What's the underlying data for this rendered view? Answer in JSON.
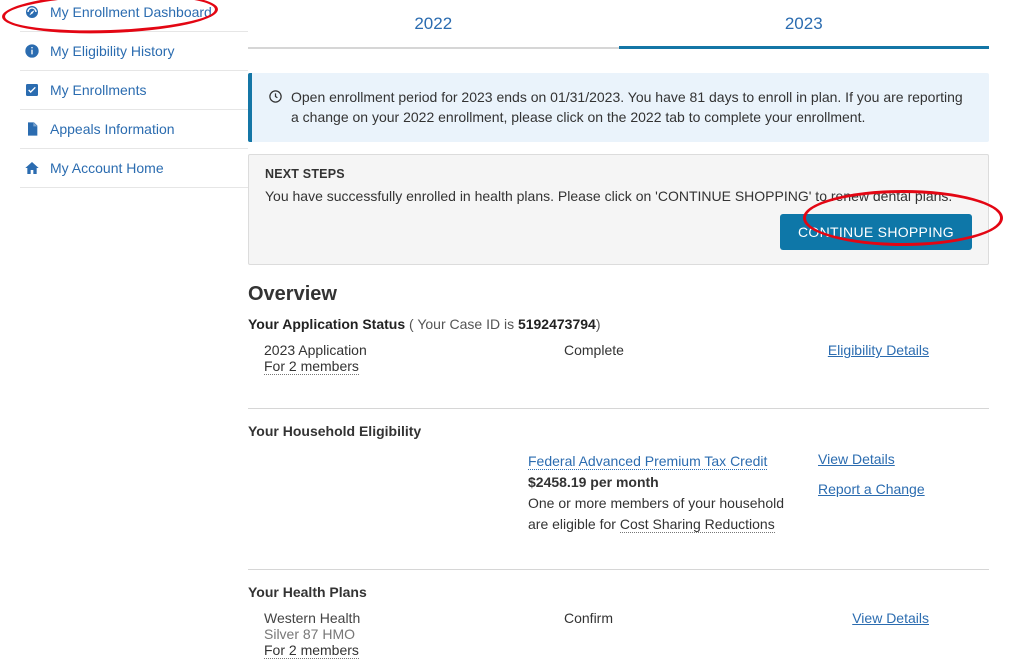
{
  "sidebar": {
    "items": [
      {
        "label": "My Enrollment Dashboard"
      },
      {
        "label": "My Eligibility History"
      },
      {
        "label": "My Enrollments"
      },
      {
        "label": "Appeals Information"
      },
      {
        "label": "My Account Home"
      }
    ]
  },
  "tabs": {
    "tab1": "2022",
    "tab2": "2023"
  },
  "banner": {
    "text": "Open enrollment period for 2023 ends on 01/31/2023. You have 81 days to enroll in plan. If you are reporting a change on your 2022 enrollment, please click on the 2022 tab to complete your enrollment."
  },
  "next_steps": {
    "title": "NEXT STEPS",
    "body": "You have successfully enrolled in health plans. Please click on 'CONTINUE SHOPPING' to renew dental plans.",
    "button": "CONTINUE SHOPPING"
  },
  "overview": {
    "heading": "Overview",
    "status_label": "Your Application Status",
    "case_label": "( Your Case ID is ",
    "case_id": "5192473794",
    "case_close": ")",
    "app_name": "2023 Application",
    "app_members": "For 2 members",
    "app_status": "Complete",
    "elig_link": "Eligibility Details"
  },
  "household": {
    "title": "Your Household Eligibility",
    "credit_label": "Federal Advanced Premium Tax Credit",
    "amount": "$2458.19 per month",
    "note_prefix": "One or more members of your household are eligible for ",
    "note_link": "Cost Sharing Reductions",
    "view_details": "View Details",
    "report_change": "Report a Change"
  },
  "healthplans": {
    "title": "Your Health Plans",
    "plan_name": "Western Health",
    "plan_type": "Silver 87 HMO",
    "plan_members": "For 2 members",
    "status": "Confirm",
    "view_details": "View Details"
  }
}
